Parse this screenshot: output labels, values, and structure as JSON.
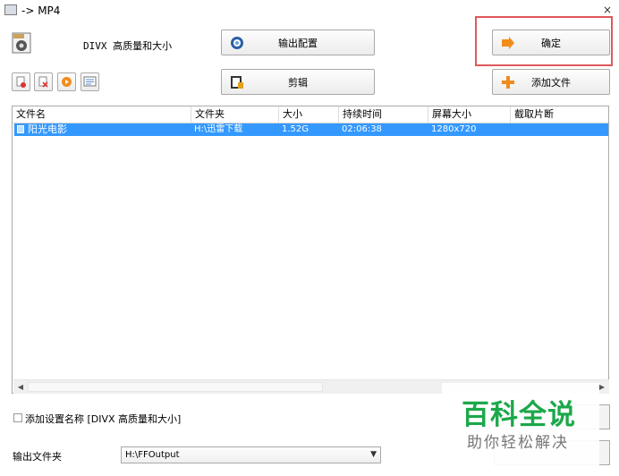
{
  "window": {
    "title": "-> MP4"
  },
  "profile": {
    "label": "DIVX 高质量和大小"
  },
  "toolbar": {
    "output_config": "输出配置",
    "cut": "剪辑",
    "ok": "确定",
    "add_file": "添加文件"
  },
  "list": {
    "headers": [
      "文件名",
      "文件夹",
      "大小",
      "持续时间",
      "屏幕大小",
      "截取片断"
    ],
    "rows": [
      {
        "name": "阳光电影",
        "folder": "H:\\迅雷下载",
        "size": "1.52G",
        "duration": "02:06:38",
        "resolution": "1280x720",
        "clip": ""
      }
    ]
  },
  "options": {
    "add_setting_label": "添加设置名称 [DIVX 高质量和大小]",
    "output_folder_label": "输出文件夹",
    "output_folder_value": "H:\\FFOutput"
  },
  "watermark": {
    "title": "百科全说",
    "subtitle": "助你轻松解决"
  },
  "colors": {
    "selection": "#3399ff",
    "highlight_box": "#e0585b",
    "watermark_green": "#1ca84a"
  }
}
